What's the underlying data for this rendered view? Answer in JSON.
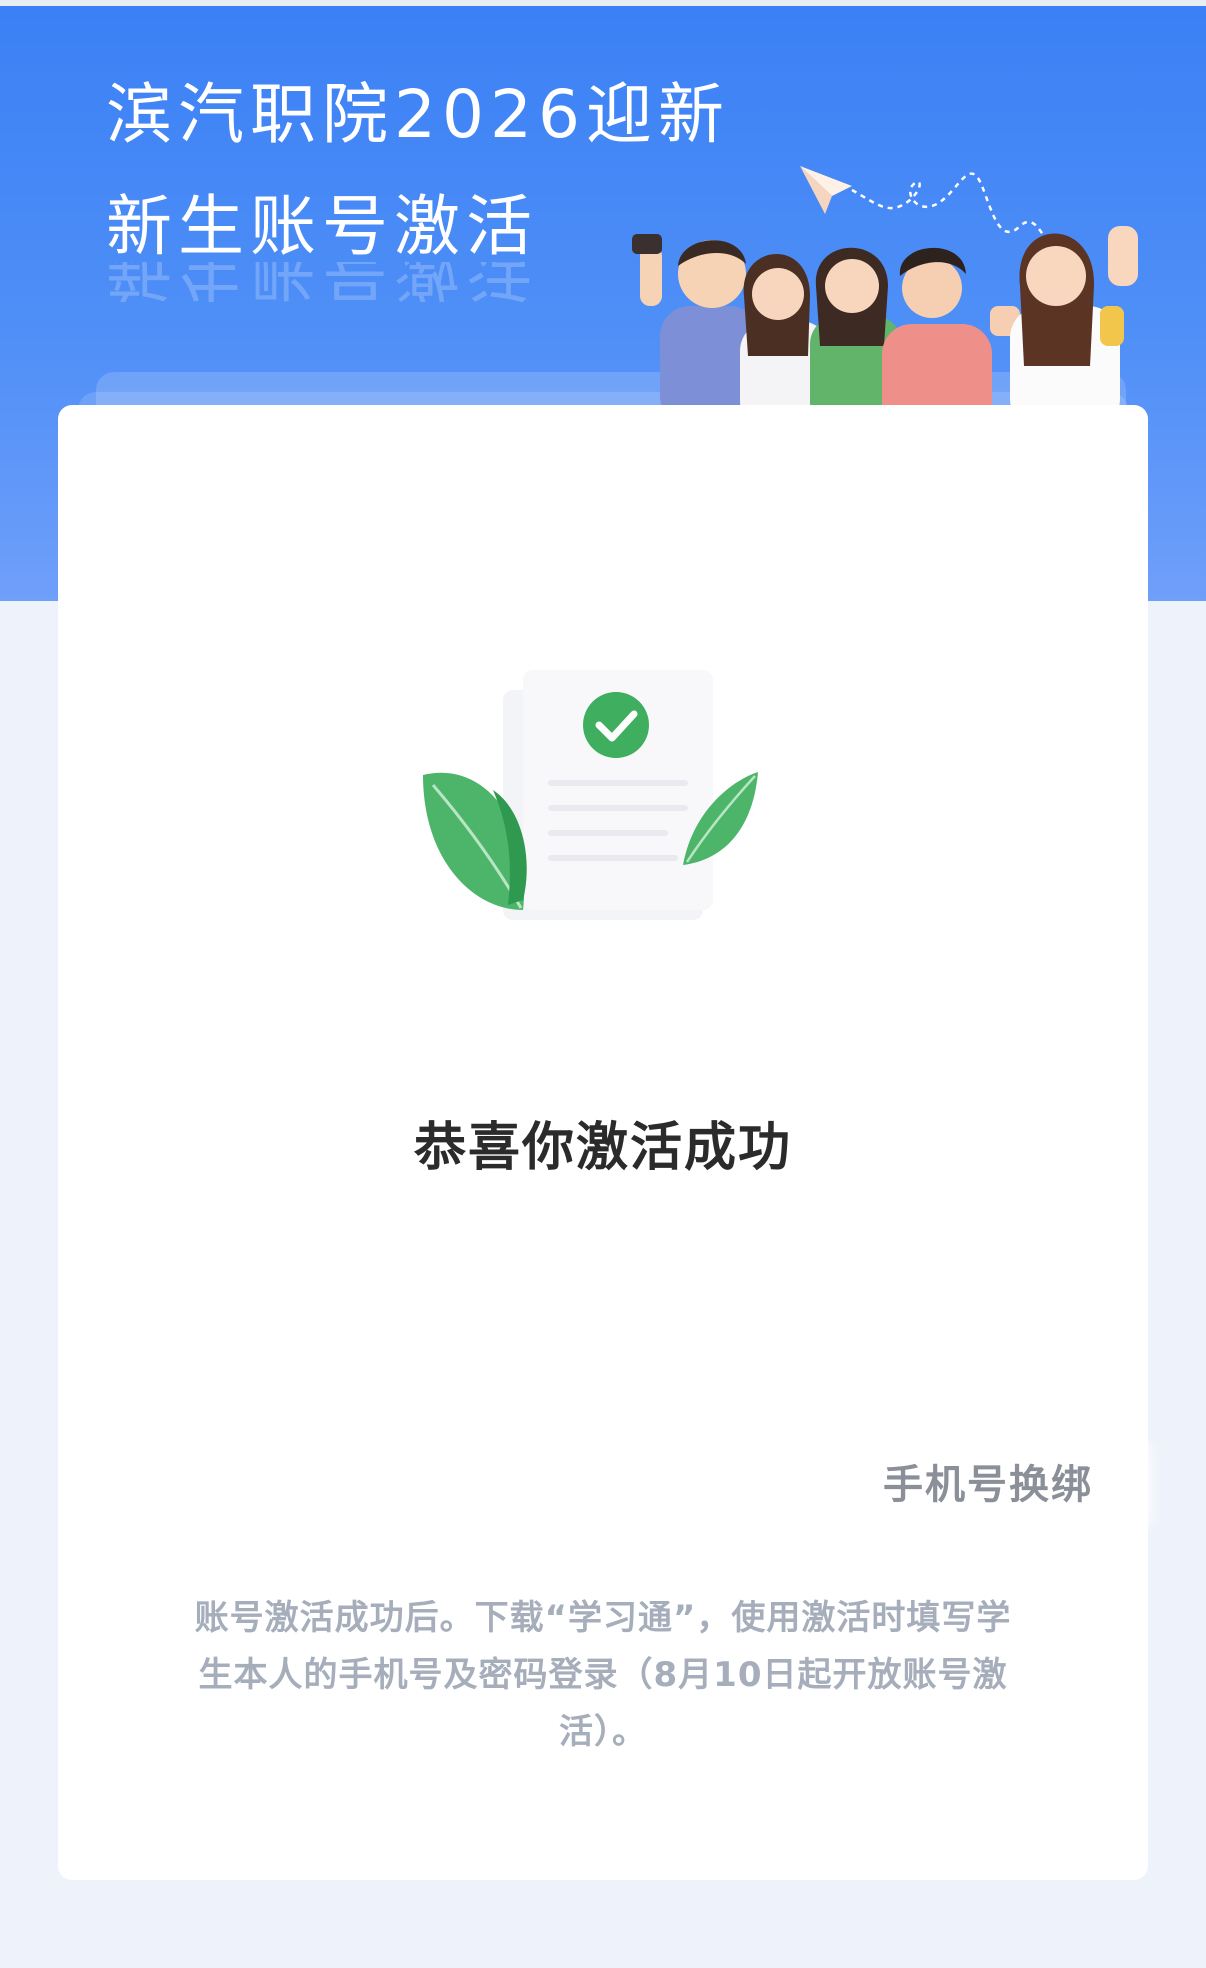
{
  "banner": {
    "title_line1": "滨汽职院2026迎新",
    "title_line2": "新生账号激活",
    "illustration": "students-group-illustration"
  },
  "card": {
    "illustration": "document-checkmark-leaves-illustration",
    "success_title": "恭喜你激活成功",
    "rebind_button_label": "手机号换绑",
    "notice_text": "账号激活成功后。下载“学习通”，使用激活时填写学生本人的手机号及密码登录（8月10日起开放账号激活）。"
  },
  "colors": {
    "banner_blue": "#3b80f5",
    "page_bg": "#eef2fb",
    "leaf_green": "#4db56a",
    "check_green": "#3fae5e",
    "notice_gray": "#a6adbb"
  }
}
